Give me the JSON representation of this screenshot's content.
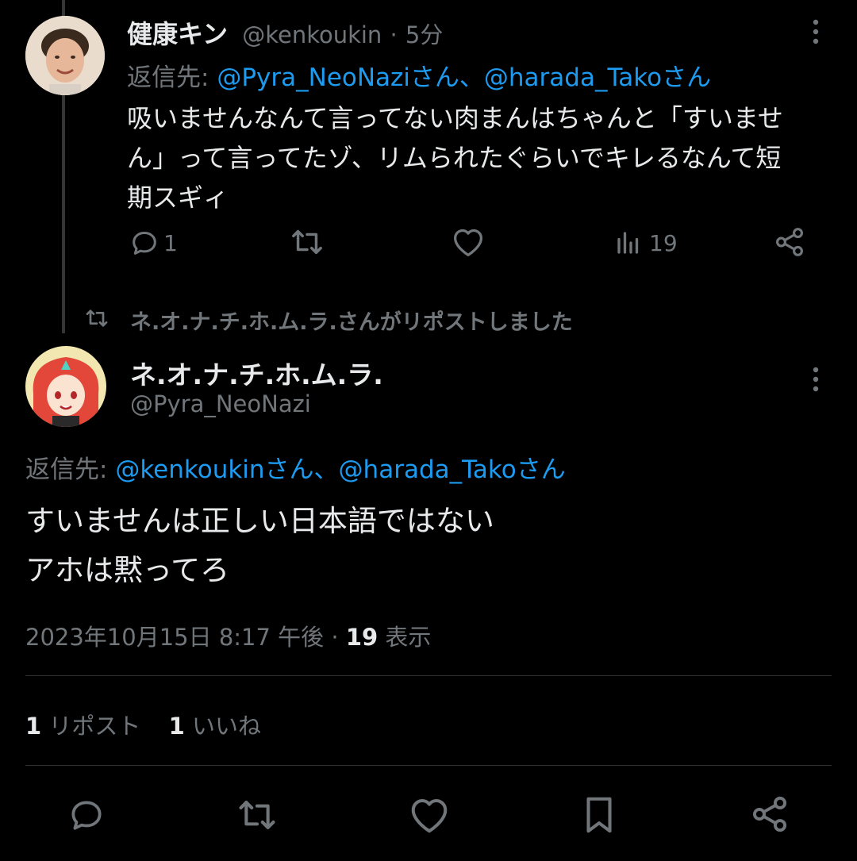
{
  "reply_tweet": {
    "display_name": "健康キン",
    "handle": "@kenkoukin",
    "separator": "·",
    "time_ago": "5分",
    "replying_prefix": "返信先:",
    "replying_to": "@Pyra_NeoNaziさん、@harada_Takoさん",
    "text_line1": "吸いませんなんて言ってない肉まんはちゃんと「すいませ",
    "text_line2": "ん」って言ってたゾ、リムられたぐらいでキレるなんて短",
    "text_line3": "期スギィ",
    "reply_count": "1",
    "view_count": "19",
    "icons": [
      "comment-icon",
      "retweet-icon",
      "heart-icon",
      "views-icon",
      "share-icon",
      "more-icon"
    ]
  },
  "repost_notice": {
    "text": "ネ.オ.ナ.チ.ホ.ム.ラ.さんがリポストしました"
  },
  "main_tweet": {
    "display_name": "ネ.オ.ナ.チ.ホ.ム.ラ.",
    "handle": "@Pyra_NeoNazi",
    "replying_prefix": "返信先:",
    "replying_to": "@kenkoukinさん、@harada_Takoさん",
    "text_line1": "すいませんは正しい日本語ではない",
    "text_line2": "アホは黙ってろ",
    "timestamp": "2023年10月15日 8:17 午後",
    "separator": "·",
    "views_num": "19",
    "views_label": "表示",
    "repost_count": "1",
    "repost_label": "リポスト",
    "like_count": "1",
    "like_label": "いいね",
    "icons": [
      "comment-icon",
      "retweet-icon",
      "heart-icon",
      "bookmark-icon",
      "share-icon",
      "more-icon"
    ]
  },
  "colors": {
    "background": "#000000",
    "text": "#e7e9ea",
    "muted": "#71767b",
    "link": "#1d9bf0",
    "divider": "#2f3336"
  }
}
